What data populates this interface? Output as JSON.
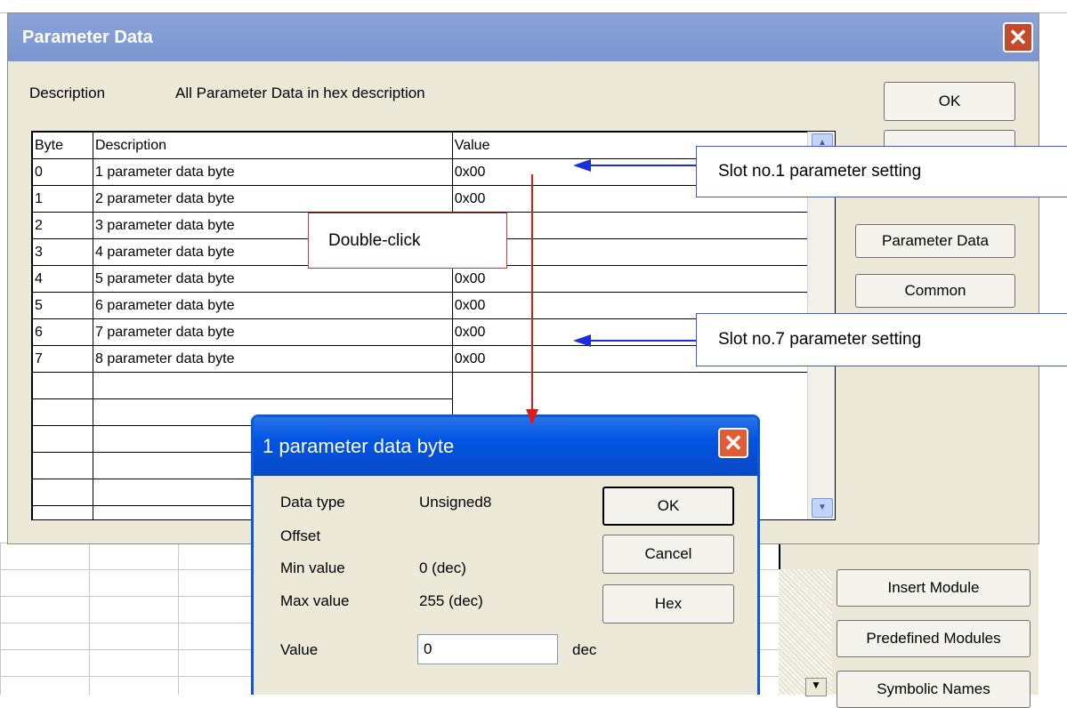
{
  "background": {
    "buttons": [
      "Insert Module",
      "Predefined Modules",
      "Symbolic Names"
    ]
  },
  "main_dialog": {
    "title": "Parameter Data",
    "description_label": "Description",
    "description_value": "All Parameter Data in hex description",
    "buttons": {
      "ok": "OK",
      "parameter_data": "Parameter Data",
      "common": "Common"
    },
    "table": {
      "headers": [
        "Byte",
        "Description",
        "Value"
      ],
      "rows": [
        {
          "byte": "0",
          "description": "1 parameter data byte",
          "value": "0x00"
        },
        {
          "byte": "1",
          "description": "2 parameter data byte",
          "value": "0x00"
        },
        {
          "byte": "2",
          "description": "3 parameter data byte",
          "value": ""
        },
        {
          "byte": "3",
          "description": "4 parameter data byte",
          "value": ""
        },
        {
          "byte": "4",
          "description": "5 parameter data byte",
          "value": "0x00"
        },
        {
          "byte": "5",
          "description": "6 parameter data byte",
          "value": "0x00"
        },
        {
          "byte": "6",
          "description": "7 parameter data byte",
          "value": "0x00"
        },
        {
          "byte": "7",
          "description": "8 parameter data byte",
          "value": "0x00"
        }
      ]
    }
  },
  "sub_dialog": {
    "title": "1 parameter data byte",
    "data_type_label": "Data type",
    "data_type_value": "Unsigned8",
    "offset_label": "Offset",
    "min_label": "Min value",
    "min_value": "0 (dec)",
    "max_label": "Max value",
    "max_value": "255 (dec)",
    "value_label": "Value",
    "value_input": "0",
    "value_unit": "dec",
    "buttons": {
      "ok": "OK",
      "cancel": "Cancel",
      "hex": "Hex"
    }
  },
  "annotations": {
    "slot1": "Slot no.1 parameter setting",
    "slot7": "Slot no.7 parameter setting",
    "double_click": "Double-click",
    "colors": {
      "blue": "#1a2ee0",
      "red": "#e01a1a"
    }
  },
  "icons": [
    "close-icon",
    "scroll-up-icon",
    "scroll-down-icon"
  ]
}
